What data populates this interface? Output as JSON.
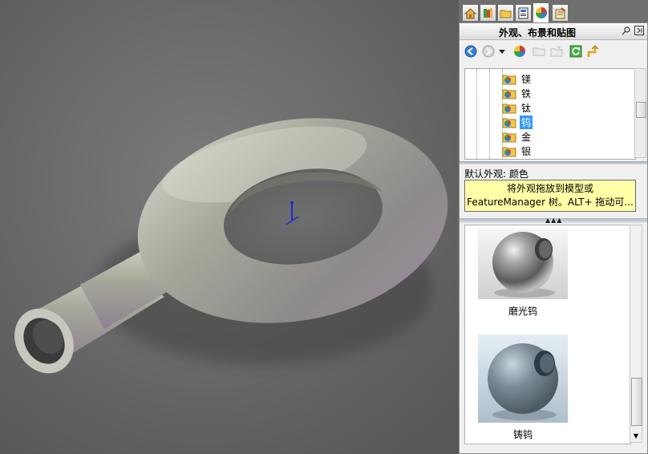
{
  "viewport": {
    "model_name": "torus-tube-part",
    "background_color": "#6b6b6b",
    "model_color": "#a3a396"
  },
  "taskpane": {
    "tabs": [
      {
        "name": "home-icon",
        "active": false
      },
      {
        "name": "design-library-icon",
        "active": false
      },
      {
        "name": "file-explorer-icon",
        "active": false
      },
      {
        "name": "view-palette-icon",
        "active": false
      },
      {
        "name": "appearances-icon",
        "active": true
      },
      {
        "name": "custom-properties-icon",
        "active": false
      }
    ],
    "panel_title": "外观、布景和贴图",
    "toolbar_icons": [
      "back-icon",
      "forward-icon",
      "dropdown-arrow-icon",
      "appearance-ball-icon",
      "open-folder-icon",
      "new-folder-icon",
      "refresh-icon",
      "up-folder-icon"
    ],
    "tree": {
      "items": [
        {
          "label": "镁",
          "selected": false
        },
        {
          "label": "铁",
          "selected": false
        },
        {
          "label": "钛",
          "selected": false
        },
        {
          "label": "钨",
          "selected": true
        },
        {
          "label": "金",
          "selected": false
        },
        {
          "label": "银",
          "selected": false
        }
      ]
    },
    "default_appearance_label": "默认外观: 颜色",
    "tip": {
      "line1": "将外观拖放到模型或",
      "line2": "FeatureManager 树。ALT+ 拖动可..."
    },
    "gallery": {
      "swatches": [
        {
          "caption": "磨光钨",
          "icon": "polished-tungsten-swatch"
        },
        {
          "caption": "铸钨",
          "icon": "cast-tungsten-swatch"
        }
      ]
    }
  },
  "colors": {
    "selection": "#3399ff",
    "tooltip_bg": "#ffffa8",
    "triad_blue": "#1a2bd1"
  }
}
